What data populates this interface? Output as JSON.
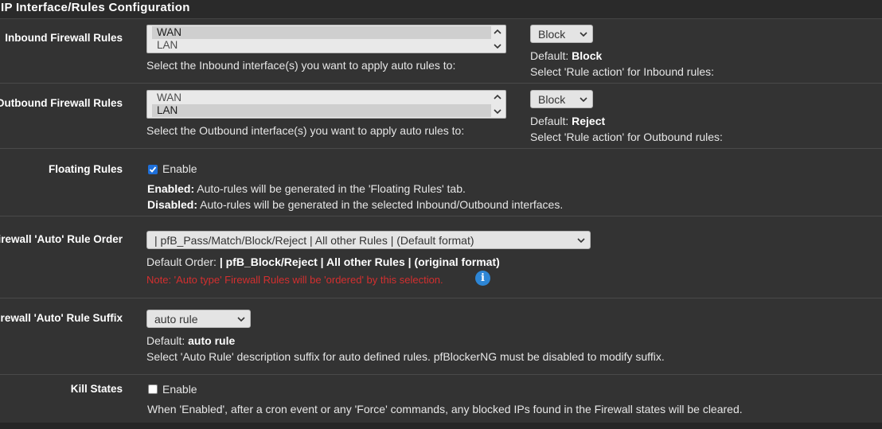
{
  "panel": {
    "title": "IP Interface/Rules Configuration"
  },
  "inbound": {
    "label": "Inbound Firewall Rules",
    "options": [
      "WAN",
      "LAN"
    ],
    "selected": "WAN",
    "help": "Select the Inbound interface(s) you want to apply auto rules to:",
    "action_value": "Block",
    "default_prefix": "Default:",
    "default_value": "Block",
    "action_help": "Select 'Rule action' for Inbound rules:"
  },
  "outbound": {
    "label": "Outbound Firewall Rules",
    "options": [
      "WAN",
      "LAN"
    ],
    "selected": "LAN",
    "help": "Select the Outbound interface(s) you want to apply auto rules to:",
    "action_value": "Block",
    "default_prefix": "Default:",
    "default_value": "Reject",
    "action_help": "Select 'Rule action' for Outbound rules:"
  },
  "floating": {
    "label": "Floating Rules",
    "checked": true,
    "checkbox_label": "Enable",
    "enabled_prefix": "Enabled:",
    "enabled_text": "Auto-rules will be generated in the 'Floating Rules' tab.",
    "disabled_prefix": "Disabled:",
    "disabled_text": "Auto-rules will be generated in the selected Inbound/Outbound interfaces."
  },
  "rule_order": {
    "label": "Firewall 'Auto' Rule Order",
    "value": "| pfB_Pass/Match/Block/Reject | All other Rules | (Default format)",
    "default_prefix": "Default Order:",
    "default_value": "| pfB_Block/Reject | All other Rules | (original format)",
    "note": "Note: 'Auto type' Firewall Rules will be 'ordered' by this selection.",
    "info_icon": "info-icon"
  },
  "rule_suffix": {
    "label": "Firewall 'Auto' Rule Suffix",
    "value": "auto rule",
    "default_prefix": "Default:",
    "default_value": "auto rule",
    "help": "Select 'Auto Rule' description suffix for auto defined rules. pfBlockerNG must be disabled to modify suffix."
  },
  "kill_states": {
    "label": "Kill States",
    "checked": false,
    "checkbox_label": "Enable",
    "help": "When 'Enabled', after a cron event or any 'Force' commands, any blocked IPs found in the Firewall states will be cleared."
  },
  "colors": {
    "note": "#d32f2f",
    "checkbox": "#1e6fd9",
    "info": "#2d86d6",
    "background": "#333333"
  }
}
